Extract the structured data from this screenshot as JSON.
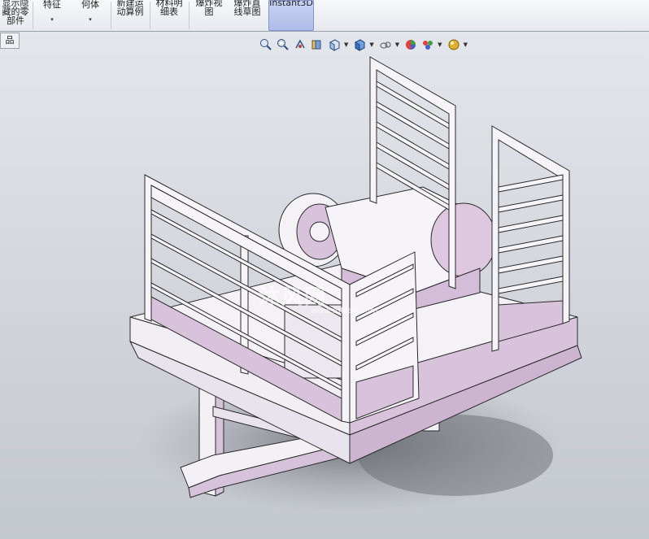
{
  "ribbon": {
    "buttons": [
      {
        "line1": "显示隐",
        "line2": "藏的零",
        "line3": "部件"
      },
      {
        "line1": "",
        "line2": "特征",
        "line3": "▾"
      },
      {
        "line1": "",
        "line2": "何体",
        "line3": "▾"
      },
      {
        "line1": "新建运",
        "line2": "动算例",
        "line3": ""
      },
      {
        "line1": "材料明",
        "line2": "细表",
        "line3": ""
      },
      {
        "line1": "爆炸视",
        "line2": "图",
        "line3": ""
      },
      {
        "line1": "爆炸直",
        "line2": "线草图",
        "line3": ""
      },
      {
        "line1": "Instant3D",
        "line2": "",
        "line3": ""
      }
    ]
  },
  "tab": {
    "label": "品"
  },
  "view_toolbar": {
    "icons": [
      "zoom-to-fit-icon",
      "zoom-area-icon",
      "previous-view-icon",
      "section-view-icon",
      "view-orientation-icon",
      "display-style-icon",
      "hide-show-items-icon",
      "edit-appearance-icon",
      "apply-scene-icon",
      "view-settings-icon"
    ]
  },
  "watermark": {
    "text": "沐风网",
    "sub": "www.mfcad.com"
  },
  "colors": {
    "frame": "#f4f2f6",
    "pink": "#d9c3dc",
    "edge": "#2a2a2a",
    "shadow": "#6d7078"
  }
}
